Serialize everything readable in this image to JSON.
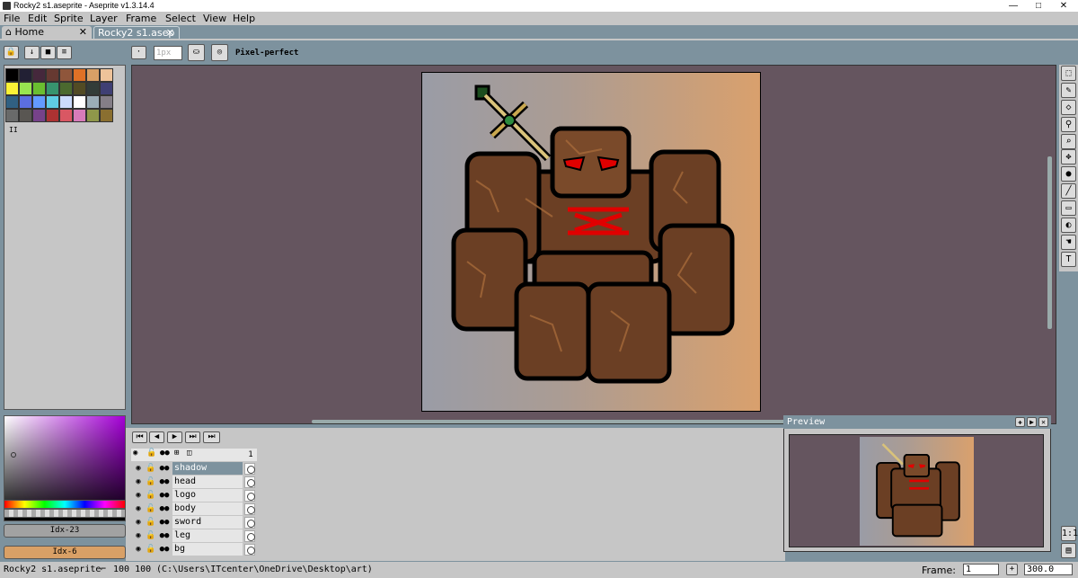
{
  "window": {
    "title": "Rocky2 s1.aseprite - Aseprite v1.3.14.4",
    "minimize": "—",
    "maximize": "□",
    "close": "✕"
  },
  "menu": [
    "File",
    "Edit",
    "Sprite",
    "Layer",
    "Frame",
    "Select",
    "View",
    "Help"
  ],
  "tabs": {
    "home": "Home",
    "file": "Rocky2 s1.asep",
    "close": "✕"
  },
  "context_bar": {
    "brush_size_placeholder": "1px",
    "pixel_perfect": "Pixel-perfect"
  },
  "palette": {
    "colors": [
      "#000000",
      "#222034",
      "#45283c",
      "#663931",
      "#8f563b",
      "#df7126",
      "#d9a066",
      "#eec39a",
      "#fbf236",
      "#99e550",
      "#6abe30",
      "#37946e",
      "#4b692f",
      "#524b24",
      "#323c39",
      "#3f3f74",
      "#306082",
      "#5b6ee1",
      "#639bff",
      "#5fcde4",
      "#cbdbfc",
      "#ffffff",
      "#9badb7",
      "#847e87",
      "#696a6a",
      "#595652",
      "#76428a",
      "#ac3232",
      "#d95763",
      "#d77bba",
      "#8f974a",
      "#8a6f30"
    ],
    "marker": "II"
  },
  "color_buttons": {
    "foreground": "Idx-23",
    "background": "Idx-6",
    "foreground_color": "#a2a2a2",
    "background_color": "#d9a066"
  },
  "layers": [
    {
      "name": "shadow",
      "selected": true
    },
    {
      "name": "head",
      "selected": false
    },
    {
      "name": "logo",
      "selected": false
    },
    {
      "name": "body",
      "selected": false
    },
    {
      "name": "sword",
      "selected": false
    },
    {
      "name": "leg",
      "selected": false
    },
    {
      "name": "bg",
      "selected": false
    }
  ],
  "timeline": {
    "frame_header": "1"
  },
  "preview": {
    "title": "Preview"
  },
  "status": {
    "file": "Rocky2 s1.aseprite",
    "dimensions": "100 100",
    "path": "(C:\\Users\\ITcenter\\OneDrive\\Desktop\\art)",
    "frame_label": "Frame:",
    "frame_value": "1",
    "zoom": "300.0"
  },
  "right_tools": [
    "marquee-icon",
    "pencil-icon",
    "eraser-icon",
    "eyedropper-icon",
    "zoom-icon",
    "move-icon",
    "fill-icon",
    "line-icon",
    "rectangle-icon",
    "blur-icon",
    "smudge-icon",
    "text-icon"
  ],
  "right_tools_bottom": {
    "one_to_one": "1:1",
    "film": "▤"
  }
}
